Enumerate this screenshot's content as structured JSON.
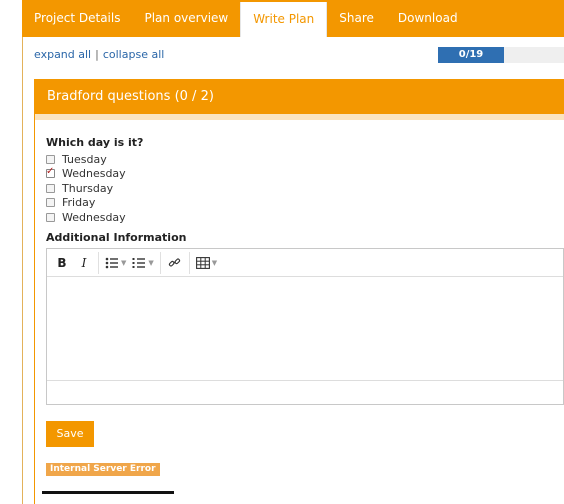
{
  "tabs": [
    {
      "label": "Project Details"
    },
    {
      "label": "Plan overview"
    },
    {
      "label": "Write Plan"
    },
    {
      "label": "Share"
    },
    {
      "label": "Download"
    }
  ],
  "active_tab": "Write Plan",
  "expand": {
    "expand_all": "expand all",
    "separator": "|",
    "collapse_all": "collapse all"
  },
  "progress": {
    "text": "0/19",
    "fraction": 0
  },
  "section": {
    "title": "Bradford questions (0 / 2)"
  },
  "question": {
    "label": "Which day is it?",
    "options": [
      {
        "label": "Tuesday",
        "checked": false
      },
      {
        "label": "Wednesday",
        "checked": true
      },
      {
        "label": "Thursday",
        "checked": false
      },
      {
        "label": "Friday",
        "checked": false
      },
      {
        "label": "Wednesday",
        "checked": false
      }
    ]
  },
  "additional": {
    "label": "Additional Information"
  },
  "editor": {
    "bold": "B",
    "italic": "I"
  },
  "save_label": "Save",
  "error_badge": "Internal Server Error",
  "colors": {
    "accent": "#f39700",
    "progress": "#2f6fb2",
    "link": "#2a66a8"
  }
}
